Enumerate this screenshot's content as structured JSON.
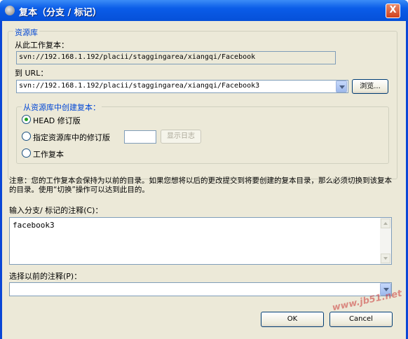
{
  "window": {
    "title": "复本（分支 / 标记）",
    "close_label": "X"
  },
  "repository": {
    "group_label": "资源库",
    "from_label": "从此工作复本：",
    "from_path": "svn://192.168.1.192/placii/staggingarea/xiangqi/Facebook",
    "to_label": "到 URL：",
    "to_url": "svn://192.168.1.192/placii/staggingarea/xiangqi/Facebook3",
    "browse_label": "浏览..."
  },
  "create_copy": {
    "group_label": "从资源库中创建复本：",
    "options": [
      {
        "label": "HEAD 修订版",
        "checked": true
      },
      {
        "label": "指定资源库中的修订版",
        "checked": false
      },
      {
        "label": "工作复本",
        "checked": false
      }
    ],
    "revision_value": "",
    "show_log_label": "显示日志"
  },
  "note": "注意：您的工作复本会保持为以前的目录。如果您想将以后的更改提交到将要创建的复本目录，那么必须切换到该复本的目录。使用“切换”操作可以达到此目的。",
  "comment": {
    "label": "输入分支/ 标记的注释(C)：",
    "value": "facebook3"
  },
  "previous_comment": {
    "label": "选择以前的注释(P)：",
    "value": ""
  },
  "buttons": {
    "ok": "OK",
    "cancel": "Cancel"
  },
  "watermark": "www.jb51.net"
}
